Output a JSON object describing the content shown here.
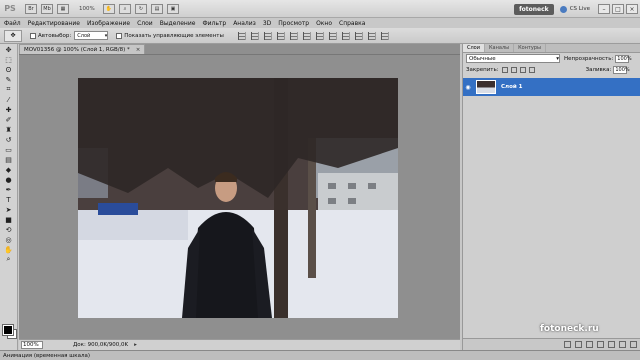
{
  "appbar": {
    "logo": "PS",
    "zoom": "100%",
    "workspace_button": "fotoneck",
    "cs_live": "CS Live",
    "min": "–",
    "restore": "□",
    "close": "×"
  },
  "menu": [
    "Файл",
    "Редактирование",
    "Изображение",
    "Слои",
    "Выделение",
    "Фильтр",
    "Анализ",
    "3D",
    "Просмотр",
    "Окно",
    "Справка"
  ],
  "options": {
    "autoselect_label": "Автовыбор:",
    "autoselect_value": "Слой",
    "show_controls_label": "Показать управляющие элементы"
  },
  "document": {
    "tab_label": "MOV01356 @ 100% (Слой 1, RGB/8) *",
    "tab_close": "×",
    "zoom": "100%",
    "doc_info": "Док: 900,0K/900,0K"
  },
  "panels": {
    "tabs": [
      "Слои",
      "Каналы",
      "Контуры"
    ],
    "blend_mode": "Обычные",
    "opacity_label": "Непрозрачность:",
    "opacity_value": "100%",
    "lock_label": "Закрепить:",
    "fill_label": "Заливка:",
    "fill_value": "100%",
    "layer_name": "Слой 1"
  },
  "animation_bar": "Анимация (временная шкала)",
  "watermark": "fotoneck.ru",
  "colors": {
    "accent": "#3470c4",
    "foreground": "#000000",
    "background": "#ffffff"
  }
}
